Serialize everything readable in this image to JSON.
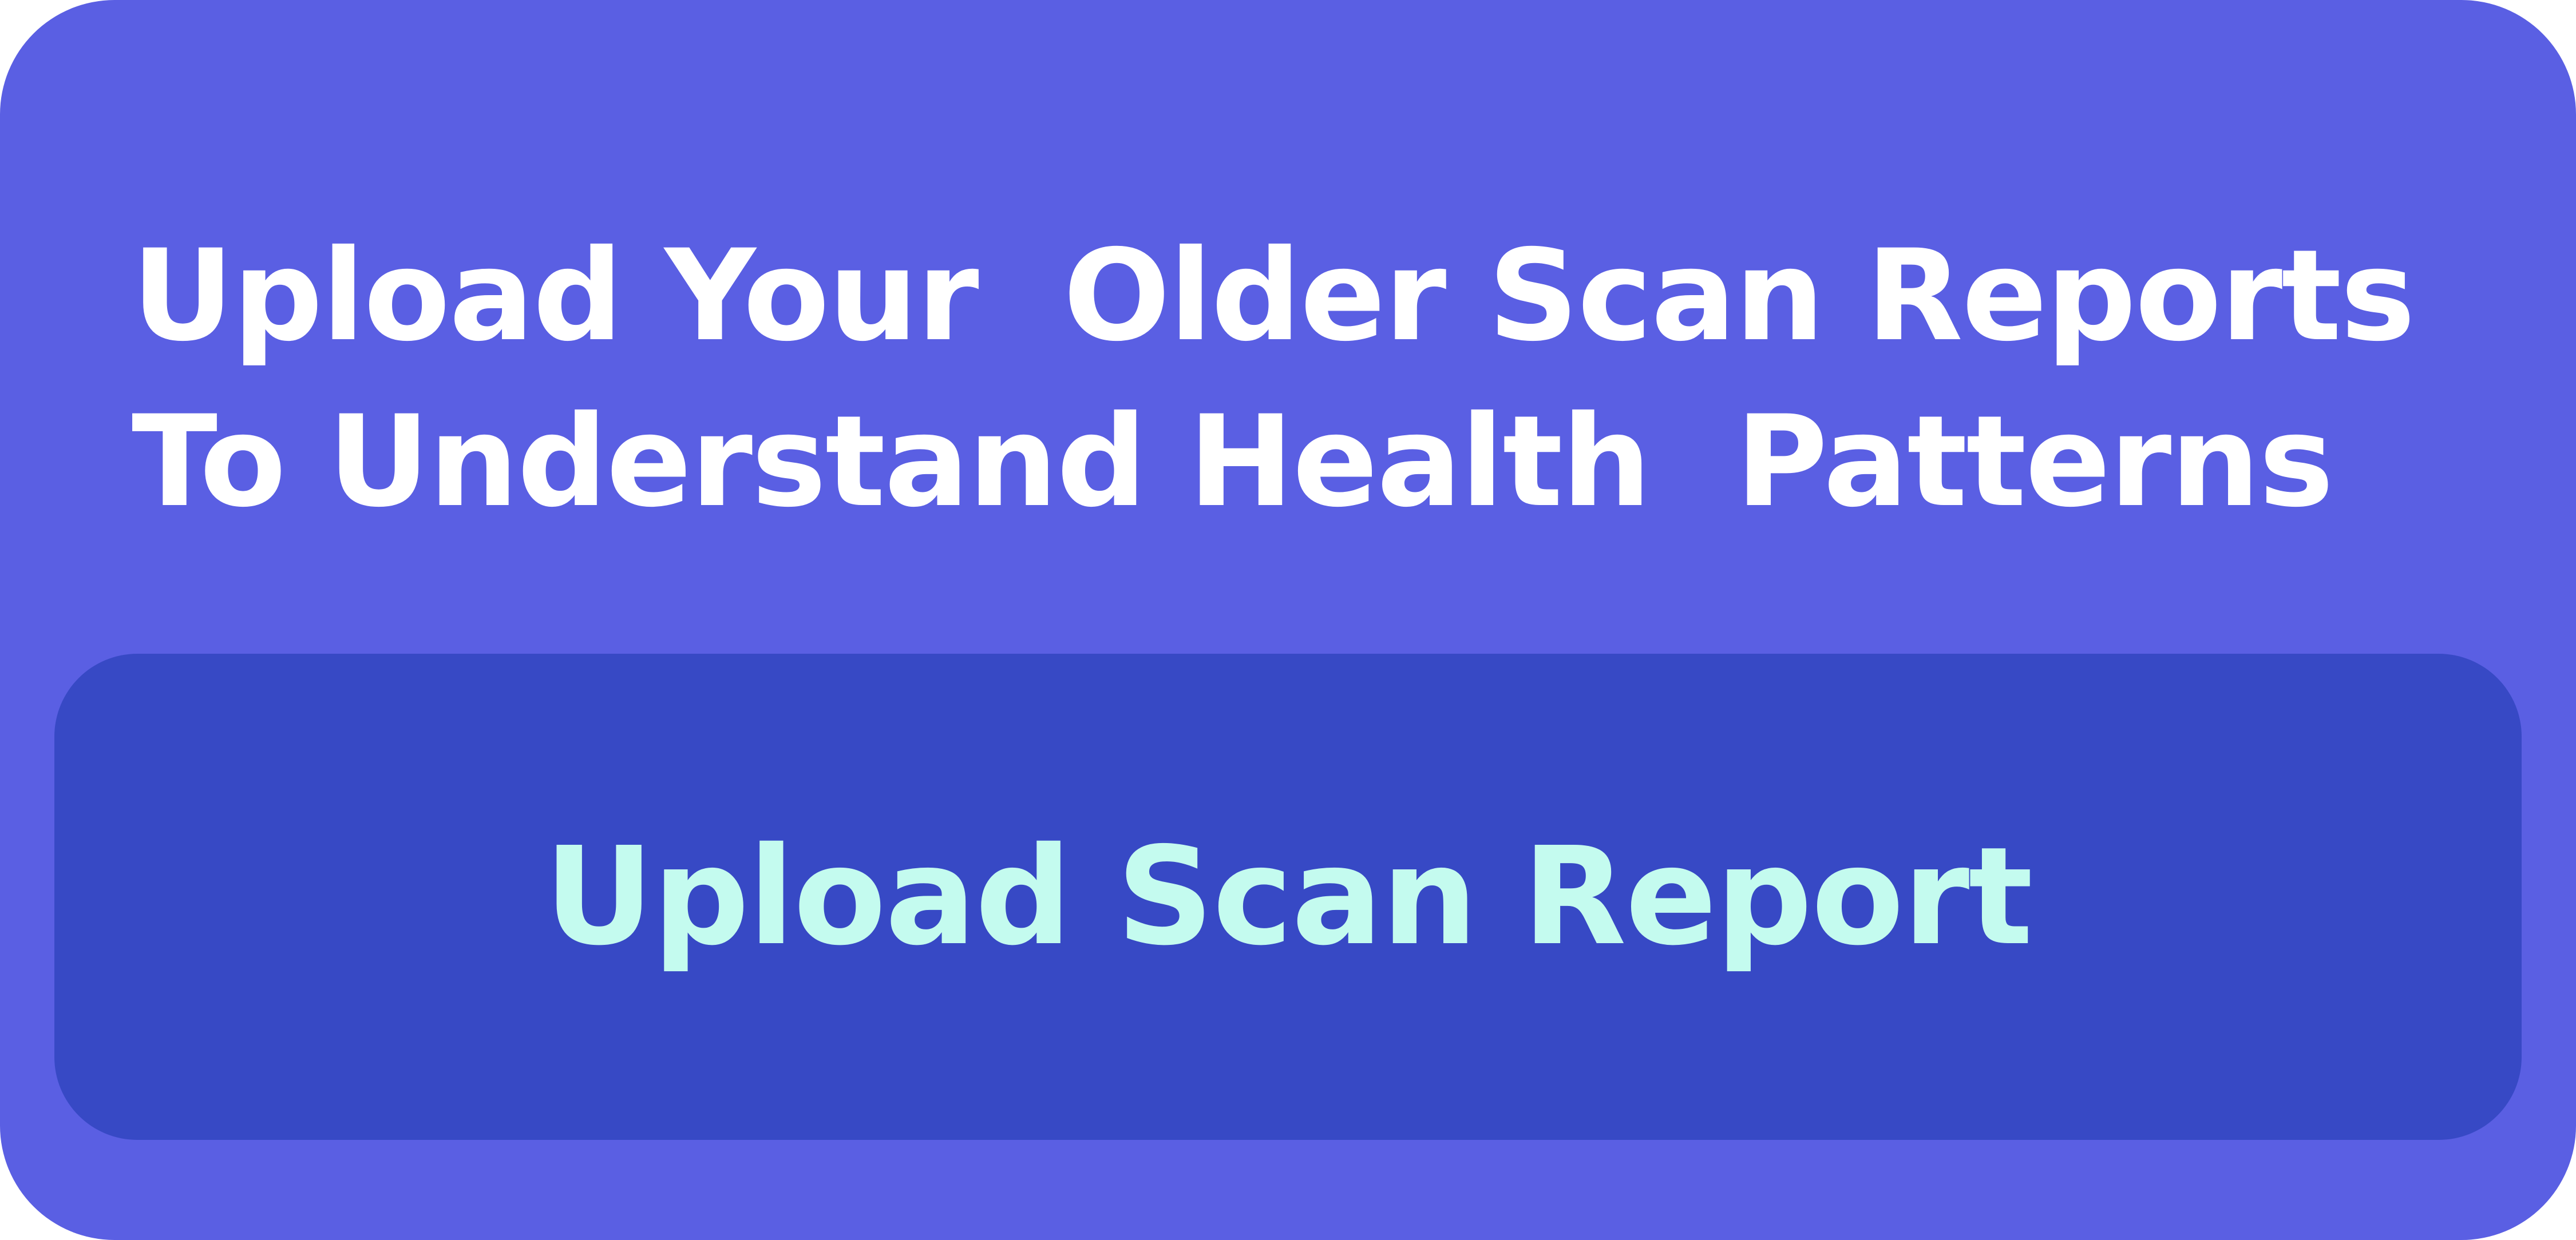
{
  "card": {
    "headline": "Upload Your  Older Scan Reports To Understand Health  Patterns",
    "button_label": "Upload Scan Report"
  },
  "colors": {
    "card_background": "#5a5fe3",
    "button_background": "#3749c5",
    "headline_text": "#ffffff",
    "button_text": "#c4fbef"
  }
}
